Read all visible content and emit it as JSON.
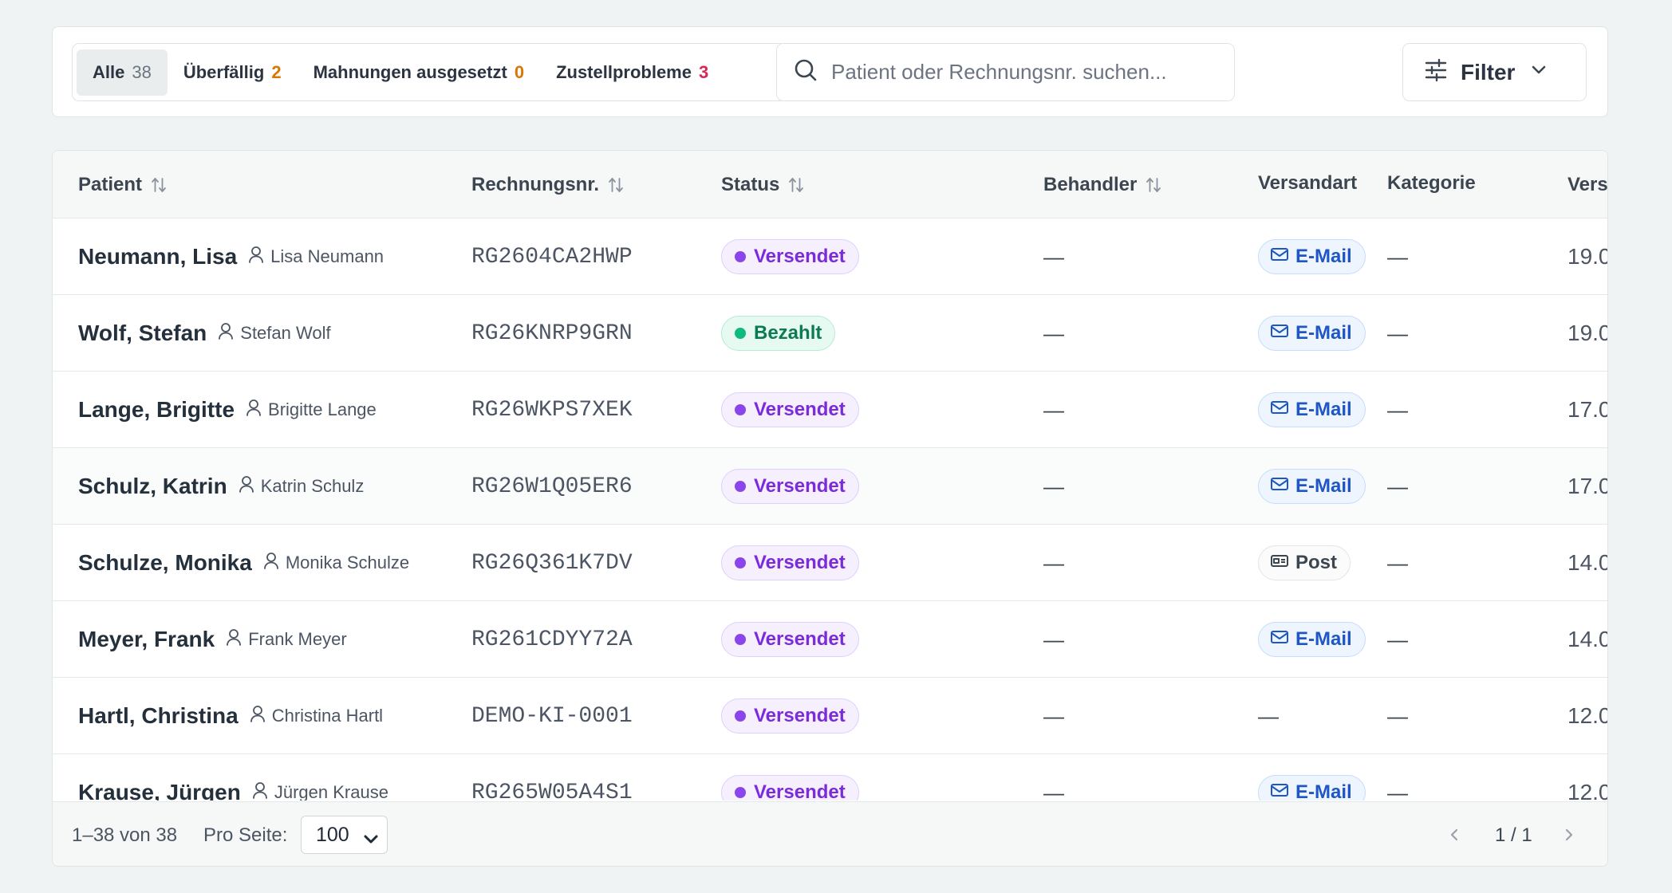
{
  "tabs": [
    {
      "label": "Alle",
      "count": "38",
      "active": true,
      "color": "#6b7480"
    },
    {
      "label": "Überfällig",
      "count": "2",
      "active": false,
      "color": "#d97706"
    },
    {
      "label": "Mahnungen ausgesetzt",
      "count": "0",
      "active": false,
      "color": "#d97706"
    },
    {
      "label": "Zustellprobleme",
      "count": "3",
      "active": false,
      "color": "#dc2654"
    }
  ],
  "search": {
    "placeholder": "Patient oder Rechnungsnr. suchen...",
    "value": "",
    "icon": "search-icon"
  },
  "filter": {
    "label": "Filter",
    "icon": "sliders-icon"
  },
  "columns": {
    "patient": "Patient",
    "rechnungsnr": "Rechnungsnr.",
    "status": "Status",
    "behandler": "Behandler",
    "versandart": "Versandart",
    "kategorie": "Kategorie",
    "versand": "Vers"
  },
  "rows": [
    {
      "name": "Neumann, Lisa",
      "user": "Lisa Neumann",
      "invoice": "RG2604CA2HWP",
      "status": "Versendet",
      "status_type": "sent",
      "behandler": "—",
      "versandart": "E-Mail",
      "versandart_type": "email",
      "kategorie": "—",
      "date": "19.0"
    },
    {
      "name": "Wolf, Stefan",
      "user": "Stefan Wolf",
      "invoice": "RG26KNRP9GRN",
      "status": "Bezahlt",
      "status_type": "paid",
      "behandler": "—",
      "versandart": "E-Mail",
      "versandart_type": "email",
      "kategorie": "—",
      "date": "19.0"
    },
    {
      "name": "Lange, Brigitte",
      "user": "Brigitte Lange",
      "invoice": "RG26WKPS7XEK",
      "status": "Versendet",
      "status_type": "sent",
      "behandler": "—",
      "versandart": "E-Mail",
      "versandart_type": "email",
      "kategorie": "—",
      "date": "17.0"
    },
    {
      "name": "Schulz, Katrin",
      "user": "Katrin Schulz",
      "invoice": "RG26W1Q05ER6",
      "status": "Versendet",
      "status_type": "sent",
      "behandler": "—",
      "versandart": "E-Mail",
      "versandart_type": "email",
      "kategorie": "—",
      "date": "17.0"
    },
    {
      "name": "Schulze, Monika",
      "user": "Monika Schulze",
      "invoice": "RG26Q361K7DV",
      "status": "Versendet",
      "status_type": "sent",
      "behandler": "—",
      "versandart": "Post",
      "versandart_type": "post",
      "kategorie": "—",
      "date": "14.0"
    },
    {
      "name": "Meyer, Frank",
      "user": "Frank Meyer",
      "invoice": "RG261CDYY72A",
      "status": "Versendet",
      "status_type": "sent",
      "behandler": "—",
      "versandart": "E-Mail",
      "versandart_type": "email",
      "kategorie": "—",
      "date": "14.0"
    },
    {
      "name": "Hartl, Christina",
      "user": "Christina Hartl",
      "invoice": "DEMO-KI-0001",
      "status": "Versendet",
      "status_type": "sent",
      "behandler": "—",
      "versandart": "—",
      "versandart_type": "none",
      "kategorie": "—",
      "date": "12.0"
    },
    {
      "name": "Krause, Jürgen",
      "user": "Jürgen Krause",
      "invoice": "RG265W05A4S1",
      "status": "Versendet",
      "status_type": "sent",
      "behandler": "—",
      "versandart": "E-Mail",
      "versandart_type": "email",
      "kategorie": "—",
      "date": "12.0"
    }
  ],
  "footer": {
    "range": "1–38 von 38",
    "per_page_label": "Pro Seite:",
    "per_page_value": "100",
    "per_page_options": [
      "100"
    ],
    "page": "1 / 1"
  },
  "colors": {
    "background": "#eff3f3",
    "status_sent": "#8b45ea",
    "status_paid": "#10b981",
    "email_badge": "#1f56c7"
  }
}
